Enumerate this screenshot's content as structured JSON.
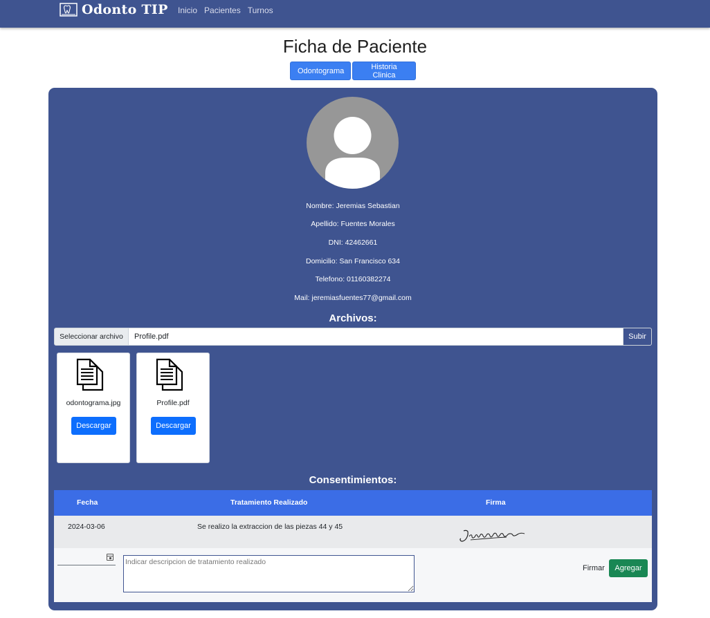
{
  "navbar": {
    "brand": "Odonto TIP",
    "links": [
      "Inicio",
      "Pacientes",
      "Turnos"
    ]
  },
  "page": {
    "title": "Ficha de Paciente",
    "buttons": {
      "odontograma": "Odontograma",
      "historia": "Historia Clinica"
    }
  },
  "patient": {
    "nombre": "Nombre: Jeremias Sebastian",
    "apellido": "Apellido: Fuentes Morales",
    "dni": "DNI: 42462661",
    "domicilio": "Domicilio: San Francisco 634",
    "telefono": "Telefono: 01160382274",
    "mail": "Mail: jeremiasfuentes77@gmail.com"
  },
  "archivos": {
    "title": "Archivos:",
    "choose_label": "Seleccionar archivo",
    "selected_file": "Profile.pdf",
    "submit_label": "Subir",
    "files": [
      {
        "name": "odontograma.jpg",
        "action": "Descargar",
        "icon": "document-icon"
      },
      {
        "name": "Profile.pdf",
        "action": "Descargar",
        "icon": "document-icon"
      }
    ]
  },
  "consentimientos": {
    "title": "Consentimientos:",
    "headers": [
      "Fecha",
      "Tratamiento Realizado",
      "Firma"
    ],
    "rows": [
      {
        "fecha": "2024-03-06",
        "tratamiento": "Se realizo la extraccion de las piezas 44 y 45",
        "firma": "signature-image"
      }
    ],
    "form": {
      "description_placeholder": "Indicar descripcion de tratamiento realizado",
      "sign_label": "Firmar",
      "add_label": "Agregar"
    }
  },
  "colors": {
    "navbar": "#3f5490",
    "card": "#3f5490",
    "primary": "#3b7ff2",
    "table_header": "#3b6de6",
    "success": "#198754"
  }
}
